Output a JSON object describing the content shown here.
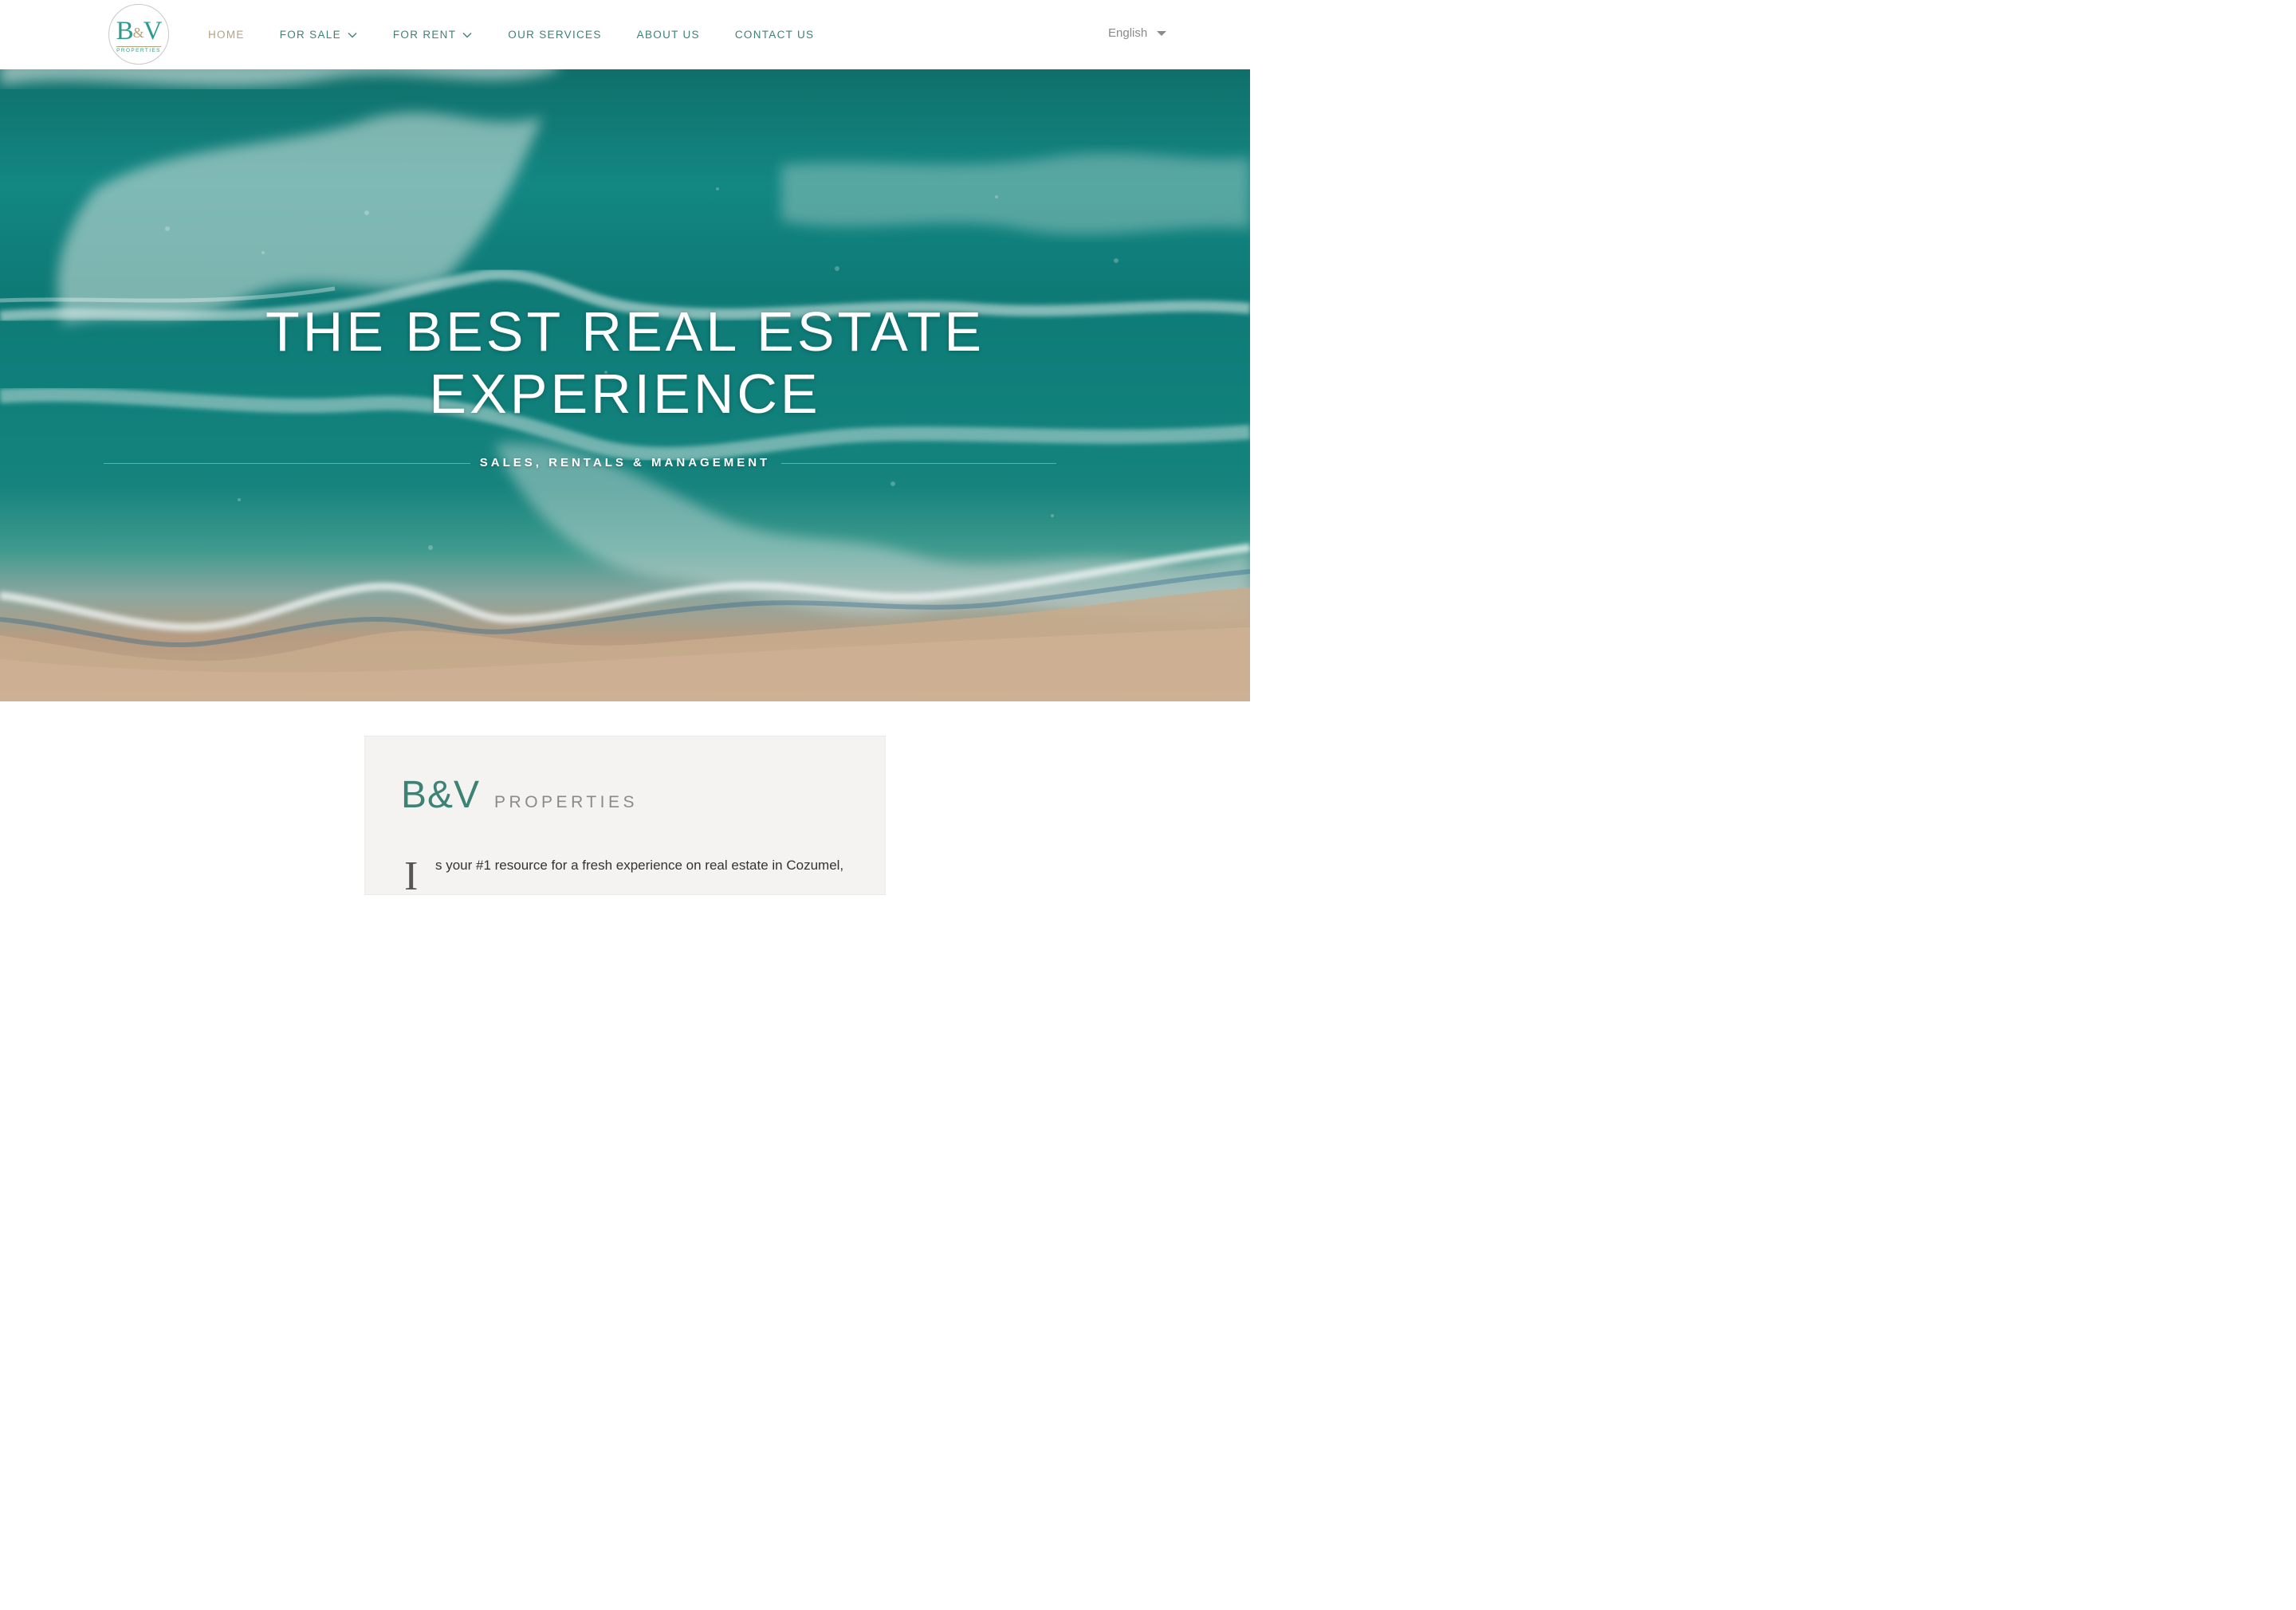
{
  "header": {
    "logo": {
      "mark": "B&V",
      "subtitle": "PROPERTIES"
    },
    "nav": [
      {
        "label": "HOME",
        "active": true,
        "has_dropdown": false
      },
      {
        "label": "FOR SALE",
        "active": false,
        "has_dropdown": true
      },
      {
        "label": "FOR RENT",
        "active": false,
        "has_dropdown": true
      },
      {
        "label": "OUR SERVICES",
        "active": false,
        "has_dropdown": false
      },
      {
        "label": "ABOUT US",
        "active": false,
        "has_dropdown": false
      },
      {
        "label": "CONTACT US",
        "active": false,
        "has_dropdown": false
      }
    ],
    "language": "English"
  },
  "hero": {
    "title_line1": "THE BEST REAL ESTATE",
    "title_line2": "EXPERIENCE",
    "subtitle": "SALES, RENTALS & MANAGEMENT"
  },
  "intro": {
    "brand": "B&V",
    "brand_suffix": "PROPERTIES",
    "dropcap": "I",
    "text": "s your #1 resource for a fresh experience on real estate in Cozumel,"
  },
  "colors": {
    "accent_teal": "#3d8275",
    "accent_gold": "#b6a280",
    "card_bg": "#f4f3f1"
  },
  "icons": {
    "nav_dropdown": "chevron-down-icon",
    "language_dropdown": "caret-down-icon"
  }
}
